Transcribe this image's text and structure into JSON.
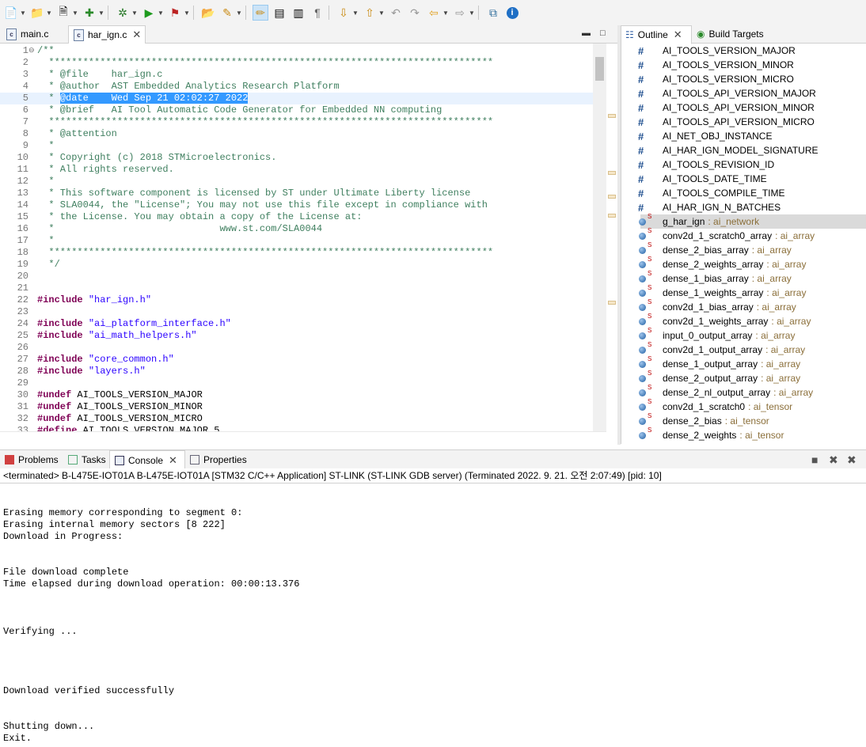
{
  "toolbar": {
    "icons": [
      "new-icon",
      "open-project-icon",
      "new-c-class-icon",
      "new-c-project-icon",
      "debug-icon",
      "run-icon",
      "external-tools-icon",
      "open-type-icon",
      "search-icon",
      "toggle-mark-occurrences-icon",
      "toggle-block-selection-icon",
      "show-whitespace-icon",
      "next-annotation-icon",
      "previous-annotation-icon",
      "last-edit-icon",
      "back-icon",
      "forward-icon",
      "open-perspective-icon",
      "info-icon"
    ]
  },
  "editor": {
    "tabs": [
      {
        "label": "main.c"
      },
      {
        "label": "har_ign.c"
      }
    ],
    "lines": [
      {
        "n": "1",
        "segments": [
          {
            "t": "/**",
            "c": "cmt"
          }
        ]
      },
      {
        "n": "2",
        "segments": [
          {
            "t": "  ******************************************************************************",
            "c": "cmt"
          }
        ]
      },
      {
        "n": "3",
        "segments": [
          {
            "t": "  * @file    har_ign.c",
            "c": "cmt"
          }
        ]
      },
      {
        "n": "4",
        "segments": [
          {
            "t": "  * @author  AST Embedded Analytics Research Platform",
            "c": "cmt"
          }
        ]
      },
      {
        "n": "5",
        "segments": [
          {
            "t": "  * ",
            "c": "cmt"
          },
          {
            "t": "@date    Wed Sep 21 02:02:27 2022",
            "c": "sel"
          }
        ]
      },
      {
        "n": "6",
        "segments": [
          {
            "t": "  * @brief   AI Tool Automatic Code Generator for Embedded NN computing",
            "c": "cmt"
          }
        ]
      },
      {
        "n": "7",
        "segments": [
          {
            "t": "  ******************************************************************************",
            "c": "cmt"
          }
        ]
      },
      {
        "n": "8",
        "segments": [
          {
            "t": "  * @attention",
            "c": "cmt"
          }
        ]
      },
      {
        "n": "9",
        "segments": [
          {
            "t": "  *",
            "c": "cmt"
          }
        ]
      },
      {
        "n": "10",
        "segments": [
          {
            "t": "  * Copyright (c) 2018 STMicroelectronics.",
            "c": "cmt"
          }
        ]
      },
      {
        "n": "11",
        "segments": [
          {
            "t": "  * All rights reserved.",
            "c": "cmt"
          }
        ]
      },
      {
        "n": "12",
        "segments": [
          {
            "t": "  *",
            "c": "cmt"
          }
        ]
      },
      {
        "n": "13",
        "segments": [
          {
            "t": "  * This software component is licensed by ST under Ultimate Liberty license",
            "c": "cmt"
          }
        ]
      },
      {
        "n": "14",
        "segments": [
          {
            "t": "  * SLA0044, the \"License\"; You may not use this file except in compliance with",
            "c": "cmt"
          }
        ]
      },
      {
        "n": "15",
        "segments": [
          {
            "t": "  * the License. You may obtain a copy of the License at:",
            "c": "cmt"
          }
        ]
      },
      {
        "n": "16",
        "segments": [
          {
            "t": "  *                             www.st.com/SLA0044",
            "c": "cmt"
          }
        ]
      },
      {
        "n": "17",
        "segments": [
          {
            "t": "  *",
            "c": "cmt"
          }
        ]
      },
      {
        "n": "18",
        "segments": [
          {
            "t": "  ******************************************************************************",
            "c": "cmt"
          }
        ]
      },
      {
        "n": "19",
        "segments": [
          {
            "t": "  */",
            "c": "cmt"
          }
        ]
      },
      {
        "n": "20",
        "segments": []
      },
      {
        "n": "21",
        "segments": []
      },
      {
        "n": "22",
        "segments": [
          {
            "t": "#include",
            "c": "kw"
          },
          {
            "t": " ",
            "c": ""
          },
          {
            "t": "\"har_ign.h\"",
            "c": "str"
          }
        ]
      },
      {
        "n": "23",
        "segments": []
      },
      {
        "n": "24",
        "segments": [
          {
            "t": "#include",
            "c": "kw"
          },
          {
            "t": " ",
            "c": ""
          },
          {
            "t": "\"ai_platform_interface.h\"",
            "c": "str"
          }
        ]
      },
      {
        "n": "25",
        "segments": [
          {
            "t": "#include",
            "c": "kw"
          },
          {
            "t": " ",
            "c": ""
          },
          {
            "t": "\"ai_math_helpers.h\"",
            "c": "str"
          }
        ]
      },
      {
        "n": "26",
        "segments": []
      },
      {
        "n": "27",
        "segments": [
          {
            "t": "#include",
            "c": "kw"
          },
          {
            "t": " ",
            "c": ""
          },
          {
            "t": "\"core_common.h\"",
            "c": "str"
          }
        ]
      },
      {
        "n": "28",
        "segments": [
          {
            "t": "#include",
            "c": "kw"
          },
          {
            "t": " ",
            "c": ""
          },
          {
            "t": "\"layers.h\"",
            "c": "str"
          }
        ]
      },
      {
        "n": "29",
        "segments": []
      },
      {
        "n": "30",
        "segments": [
          {
            "t": "#undef",
            "c": "kw"
          },
          {
            "t": " AI_TOOLS_VERSION_MAJOR",
            "c": ""
          }
        ]
      },
      {
        "n": "31",
        "segments": [
          {
            "t": "#undef",
            "c": "kw"
          },
          {
            "t": " AI_TOOLS_VERSION_MINOR",
            "c": ""
          }
        ]
      },
      {
        "n": "32",
        "segments": [
          {
            "t": "#undef",
            "c": "kw"
          },
          {
            "t": " AI_TOOLS_VERSION_MICRO",
            "c": ""
          }
        ]
      },
      {
        "n": "33",
        "segments": [
          {
            "t": "#define",
            "c": "kw"
          },
          {
            "t": " AI_TOOLS_VERSION_MAJOR 5",
            "c": ""
          }
        ]
      }
    ]
  },
  "outline": {
    "tabs": [
      {
        "label": "Outline"
      },
      {
        "label": "Build Targets"
      }
    ],
    "items": [
      {
        "kind": "macro",
        "name": "AI_TOOLS_VERSION_MAJOR",
        "type": ""
      },
      {
        "kind": "macro",
        "name": "AI_TOOLS_VERSION_MINOR",
        "type": ""
      },
      {
        "kind": "macro",
        "name": "AI_TOOLS_VERSION_MICRO",
        "type": ""
      },
      {
        "kind": "macro",
        "name": "AI_TOOLS_API_VERSION_MAJOR",
        "type": ""
      },
      {
        "kind": "macro",
        "name": "AI_TOOLS_API_VERSION_MINOR",
        "type": ""
      },
      {
        "kind": "macro",
        "name": "AI_TOOLS_API_VERSION_MICRO",
        "type": ""
      },
      {
        "kind": "macro",
        "name": "AI_NET_OBJ_INSTANCE",
        "type": ""
      },
      {
        "kind": "macro",
        "name": "AI_HAR_IGN_MODEL_SIGNATURE",
        "type": ""
      },
      {
        "kind": "macro",
        "name": "AI_TOOLS_REVISION_ID",
        "type": ""
      },
      {
        "kind": "macro",
        "name": "AI_TOOLS_DATE_TIME",
        "type": ""
      },
      {
        "kind": "macro",
        "name": "AI_TOOLS_COMPILE_TIME",
        "type": ""
      },
      {
        "kind": "macro",
        "name": "AI_HAR_IGN_N_BATCHES",
        "type": ""
      },
      {
        "kind": "var",
        "name": "g_har_ign",
        "type": ": ai_network",
        "selected": true
      },
      {
        "kind": "var",
        "name": "conv2d_1_scratch0_array",
        "type": ": ai_array"
      },
      {
        "kind": "var",
        "name": "dense_2_bias_array",
        "type": ": ai_array"
      },
      {
        "kind": "var",
        "name": "dense_2_weights_array",
        "type": ": ai_array"
      },
      {
        "kind": "var",
        "name": "dense_1_bias_array",
        "type": ": ai_array"
      },
      {
        "kind": "var",
        "name": "dense_1_weights_array",
        "type": ": ai_array"
      },
      {
        "kind": "var",
        "name": "conv2d_1_bias_array",
        "type": ": ai_array"
      },
      {
        "kind": "var",
        "name": "conv2d_1_weights_array",
        "type": ": ai_array"
      },
      {
        "kind": "var",
        "name": "input_0_output_array",
        "type": ": ai_array"
      },
      {
        "kind": "var",
        "name": "conv2d_1_output_array",
        "type": ": ai_array"
      },
      {
        "kind": "var",
        "name": "dense_1_output_array",
        "type": ": ai_array"
      },
      {
        "kind": "var",
        "name": "dense_2_output_array",
        "type": ": ai_array"
      },
      {
        "kind": "var",
        "name": "dense_2_nl_output_array",
        "type": ": ai_array"
      },
      {
        "kind": "var",
        "name": "conv2d_1_scratch0",
        "type": ": ai_tensor"
      },
      {
        "kind": "var",
        "name": "dense_2_bias",
        "type": ": ai_tensor"
      },
      {
        "kind": "var",
        "name": "dense_2_weights",
        "type": ": ai_tensor"
      }
    ]
  },
  "console": {
    "tabs": [
      {
        "label": "Problems"
      },
      {
        "label": "Tasks"
      },
      {
        "label": "Console"
      },
      {
        "label": "Properties"
      }
    ],
    "status": "<terminated> B-L475E-IOT01A B-L475E-IOT01A [STM32 C/C++ Application] ST-LINK (ST-LINK GDB server) (Terminated 2022. 9. 21. 오전 2:07:49) [pid: 10]",
    "lines": [
      "",
      "",
      "Erasing memory corresponding to segment 0:",
      "Erasing internal memory sectors [8 222]",
      "Download in Progress:",
      "",
      "",
      "File download complete",
      "Time elapsed during download operation: 00:00:13.376",
      "",
      "",
      "",
      "Verifying ...",
      "",
      "",
      "",
      "",
      "Download verified successfully",
      "",
      "",
      "Shutting down...",
      "Exit."
    ]
  }
}
